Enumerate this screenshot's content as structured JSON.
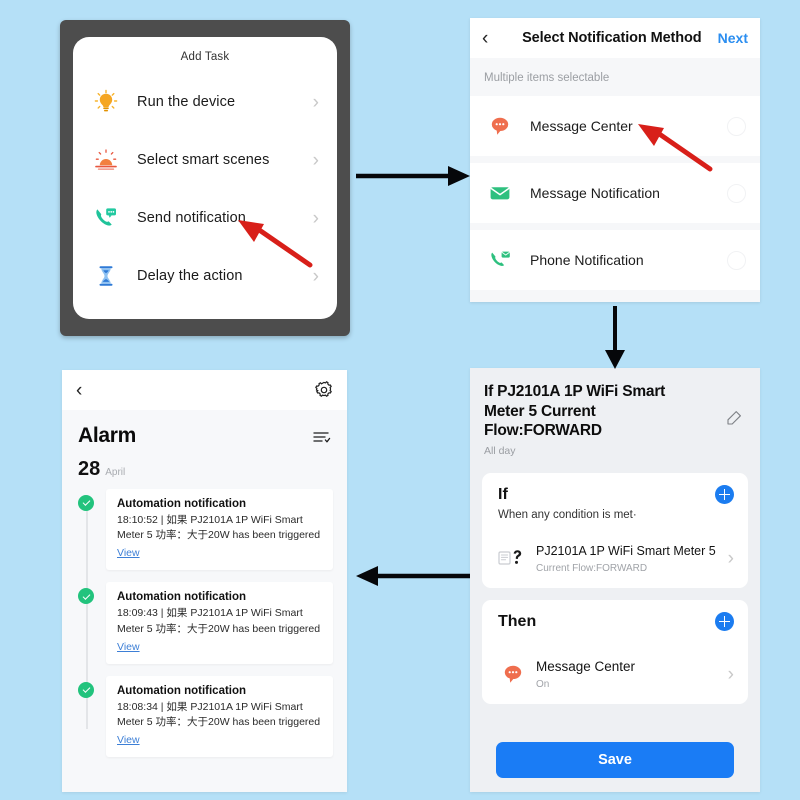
{
  "background_color": "#b5e0f7",
  "accent_blue": "#1a7cf5",
  "panel_add_task": {
    "title": "Add Task",
    "items": [
      {
        "label": "Run the device",
        "icon": "lightbulb-icon",
        "color": "#f5a623"
      },
      {
        "label": "Select smart scenes",
        "icon": "sunrise-scene-icon",
        "color": "#e8573f"
      },
      {
        "label": "Send notification",
        "icon": "phone-message-icon",
        "color": "#1fc39a"
      },
      {
        "label": "Delay the action",
        "icon": "hourglass-icon",
        "color": "#2f7ad6"
      }
    ],
    "chevron": "›"
  },
  "panel_notify_method": {
    "back_icon": "chevron-left-icon",
    "title": "Select Notification Method",
    "next_label": "Next",
    "subtitle": "Multiple items selectable",
    "items": [
      {
        "label": "Message Center",
        "icon": "speech-bubble-icon",
        "color": "#ef6e4e",
        "selected": false
      },
      {
        "label": "Message Notification",
        "icon": "envelope-icon",
        "color": "#2ec07f",
        "selected": false
      },
      {
        "label": "Phone Notification",
        "icon": "phone-envelope-icon",
        "color": "#2ec07f",
        "selected": false
      }
    ]
  },
  "panel_automation": {
    "title": "If PJ2101A 1P WiFi Smart Meter  5 Current Flow:FORWARD",
    "schedule": "All day",
    "edit_icon": "pencil-icon",
    "if_card": {
      "heading": "If",
      "condition_mode": "When any condition is met·",
      "add_icon": "plus-circle-icon",
      "item": {
        "name": "PJ2101A 1P WiFi Smart Meter 5",
        "sub": "Current Flow:FORWARD",
        "icon": "smart-meter-icon",
        "chevron": "›"
      }
    },
    "then_card": {
      "heading": "Then",
      "add_icon": "plus-circle-icon",
      "item": {
        "name": "Message Center",
        "sub": "On",
        "icon": "speech-bubble-icon",
        "chevron": "›"
      }
    },
    "save_label": "Save"
  },
  "panel_alarm": {
    "back_icon": "chevron-left-icon",
    "gear_icon": "gear-icon",
    "title": "Alarm",
    "filter_icon": "filter-list-icon",
    "date_day": "28",
    "date_month": "April",
    "view_label": "View",
    "notifications": [
      {
        "title": "Automation notification",
        "body": "18:10:52 | 如果 PJ2101A 1P WiFi Smart Meter  5 功率：大于20W has been triggered",
        "status": "read-check"
      },
      {
        "title": "Automation notification",
        "body": "18:09:43 | 如果 PJ2101A 1P WiFi Smart Meter  5 功率：大于20W has been triggered",
        "status": "read-check"
      },
      {
        "title": "Automation notification",
        "body": "18:08:34 | 如果 PJ2101A 1P WiFi Smart Meter  5 功率：大于20W has been triggered",
        "status": "read-check"
      }
    ]
  },
  "connectors": [
    {
      "name": "arrow-add-task-to-notify-method",
      "direction": "right",
      "color": "#06070a"
    },
    {
      "name": "arrow-notify-method-to-automation",
      "direction": "down",
      "color": "#06070a"
    },
    {
      "name": "arrow-automation-to-alarm",
      "direction": "left",
      "color": "#06070a"
    }
  ],
  "annotations": [
    {
      "name": "red-pointer-send-notification",
      "color": "#d81f19"
    },
    {
      "name": "red-pointer-message-center",
      "color": "#d81f19"
    }
  ]
}
